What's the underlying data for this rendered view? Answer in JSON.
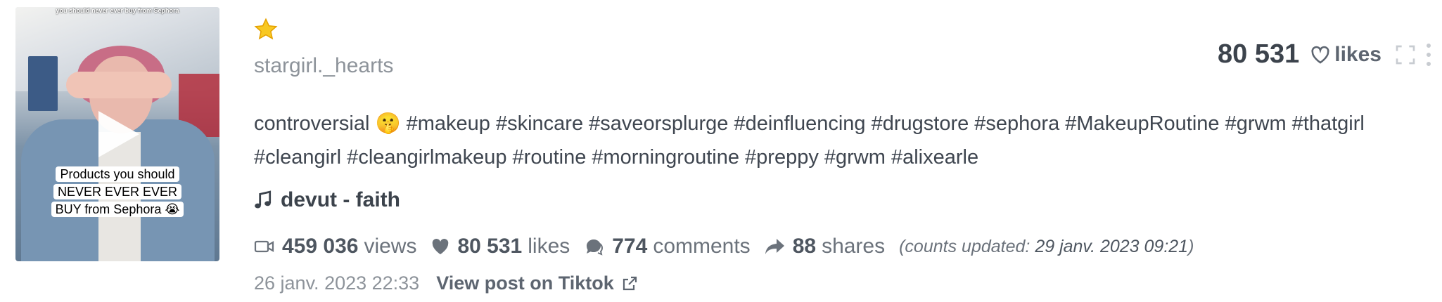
{
  "video": {
    "overlay_top_text": "you should never ever buy from Sephora",
    "caption": "Products you should NEVER EVER EVER BUY from Sephora 😭"
  },
  "author": "stargirl._hearts",
  "likes_top": {
    "count": "80 531",
    "label": "likes"
  },
  "description": "controversial 🤫 #makeup #skincare #saveorsplurge #deinfluencing #drugstore #sephora #MakeupRoutine #grwm #thatgirl #cleangirl #cleangirlmakeup #routine #morningroutine #preppy #grwm #alixearle",
  "music": "devut - faith",
  "stats": {
    "views": {
      "count": "459 036",
      "label": "views"
    },
    "likes": {
      "count": "80 531",
      "label": "likes"
    },
    "comments": {
      "count": "774",
      "label": "comments"
    },
    "shares": {
      "count": "88",
      "label": "shares"
    },
    "updated_prefix": "(counts updated: ",
    "updated_date": "29 janv. 2023 09:21",
    "updated_suffix": ")"
  },
  "footer": {
    "date": "26 janv. 2023 22:33",
    "link": "View post on Tiktok"
  },
  "icons": {
    "star": "star-icon",
    "heart": "heart-outline-icon",
    "expand": "expand-icon",
    "menu": "more-vertical-icon",
    "music": "music-note-icon",
    "video": "video-camera-icon",
    "like": "heart-icon",
    "comment": "comment-icon",
    "share": "share-icon",
    "external": "external-link-icon"
  },
  "colors": {
    "star": "#f5c518",
    "text": "#3f4650",
    "muted": "#8d939a"
  }
}
